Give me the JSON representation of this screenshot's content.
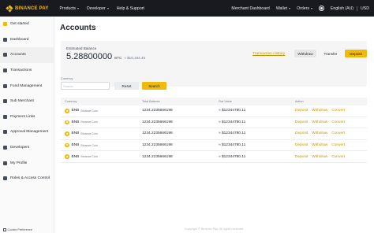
{
  "topbar": {
    "logo_text": "BINANCE PAY",
    "nav": [
      {
        "label": "Products",
        "dropdown": true
      },
      {
        "label": "Developer",
        "dropdown": true
      },
      {
        "label": "Help & Support",
        "dropdown": false
      }
    ],
    "right": {
      "merchant_dashboard": "Merchant Dashboard",
      "wallet": "Wallet",
      "orders": "Orders",
      "language": "English (AU)",
      "currency": "USD"
    }
  },
  "sidebar": {
    "items": [
      {
        "label": "Get started",
        "icon": "gold-square-icon"
      },
      {
        "label": "Dashboard",
        "icon": "dashboard-icon"
      },
      {
        "label": "Accounts",
        "icon": "accounts-icon"
      },
      {
        "label": "Transactions",
        "icon": "transactions-icon"
      },
      {
        "label": "Fund Management",
        "icon": "fund-icon"
      },
      {
        "label": "Sub Merchant",
        "icon": "merchant-icon"
      },
      {
        "label": "Payment Links",
        "icon": "link-icon"
      },
      {
        "label": "Approval Management",
        "icon": "approval-icon"
      },
      {
        "label": "Developers",
        "icon": "code-icon"
      },
      {
        "label": "My Profile",
        "icon": "profile-icon"
      },
      {
        "label": "Roles & Access Control",
        "icon": "roles-icon"
      }
    ],
    "cookie_preference": "Cookie Preference"
  },
  "main": {
    "title": "Accounts",
    "balance": {
      "label": "Estimated Balance",
      "amount": "5.28800000",
      "unit": "BTC",
      "fiat": "≈ $16,184.45",
      "transaction_history": "Transaction History",
      "withdraw": "Withdraw",
      "transfer": "Transfer",
      "deposit": "Deposit"
    },
    "filter": {
      "label": "Currency",
      "placeholder": "Search",
      "reset": "Reset",
      "search": "Search"
    },
    "table": {
      "headers": [
        "Currency",
        "Total Balance",
        "Fiat Value",
        "Action"
      ],
      "rows": [
        {
          "symbol": "BNB",
          "name": "Binance Coin",
          "total": "1234.2235666198",
          "fiat": "≈ $12344780.11"
        },
        {
          "symbol": "BNB",
          "name": "Binance Coin",
          "total": "1234.2235666198",
          "fiat": "≈ $12344780.11"
        },
        {
          "symbol": "BNB",
          "name": "Binance Coin",
          "total": "1234.2235666198",
          "fiat": "≈ $12344780.11"
        },
        {
          "symbol": "BNB",
          "name": "Binance Coin",
          "total": "1234.2235666198",
          "fiat": "≈ $12344780.11"
        },
        {
          "symbol": "BNB",
          "name": "Binance Coin",
          "total": "1234.2235666198",
          "fiat": "≈ $12344780.11"
        }
      ],
      "actions": [
        "Deposit",
        "Withdraw",
        "Convert"
      ]
    },
    "footer": "Copyright © Binance Pay. All rights reserved."
  }
}
